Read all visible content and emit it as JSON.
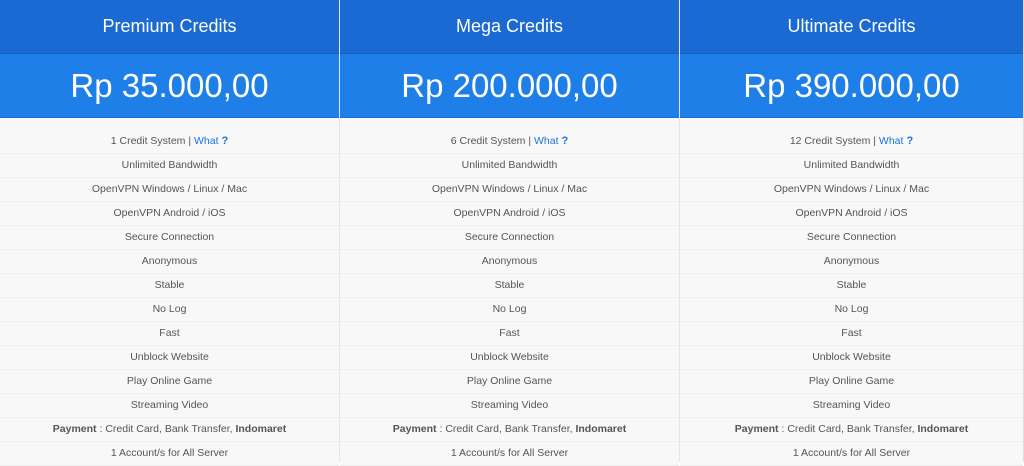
{
  "plans": [
    {
      "title": "Premium Credits",
      "price": "Rp 35.000,00",
      "credit_system": "1 Credit System",
      "separator": " | ",
      "what": "What",
      "help": "?",
      "bandwidth": "Unlimited Bandwidth",
      "openvpn_desktop": "OpenVPN Windows / Linux / Mac",
      "openvpn_mobile": "OpenVPN Android / iOS",
      "secure": "Secure Connection",
      "anonymous": "Anonymous",
      "stable": "Stable",
      "nolog": "No Log",
      "fast": "Fast",
      "unblock": "Unblock Website",
      "game": "Play Online Game",
      "video": "Streaming Video",
      "payment_label": "Payment",
      "payment_methods": " : Credit Card, Bank Transfer, ",
      "payment_bold": "Indomaret",
      "accounts": "1 Account/s for All Server"
    },
    {
      "title": "Mega Credits",
      "price": "Rp 200.000,00",
      "credit_system": "6 Credit System",
      "separator": " | ",
      "what": "What",
      "help": "?",
      "bandwidth": "Unlimited Bandwidth",
      "openvpn_desktop": "OpenVPN Windows / Linux / Mac",
      "openvpn_mobile": "OpenVPN Android / iOS",
      "secure": "Secure Connection",
      "anonymous": "Anonymous",
      "stable": "Stable",
      "nolog": "No Log",
      "fast": "Fast",
      "unblock": "Unblock Website",
      "game": "Play Online Game",
      "video": "Streaming Video",
      "payment_label": "Payment",
      "payment_methods": " : Credit Card, Bank Transfer, ",
      "payment_bold": "Indomaret",
      "accounts": "1 Account/s for All Server"
    },
    {
      "title": "Ultimate Credits",
      "price": "Rp 390.000,00",
      "credit_system": "12 Credit System",
      "separator": " | ",
      "what": "What",
      "help": "?",
      "bandwidth": "Unlimited Bandwidth",
      "openvpn_desktop": "OpenVPN Windows / Linux / Mac",
      "openvpn_mobile": "OpenVPN Android / iOS",
      "secure": "Secure Connection",
      "anonymous": "Anonymous",
      "stable": "Stable",
      "nolog": "No Log",
      "fast": "Fast",
      "unblock": "Unblock Website",
      "game": "Play Online Game",
      "video": "Streaming Video",
      "payment_label": "Payment",
      "payment_methods": " : Credit Card, Bank Transfer, ",
      "payment_bold": "Indomaret",
      "accounts": "1 Account/s for All Server"
    }
  ],
  "colors": {
    "header_blue": "#1b6ad4",
    "price_blue": "#1f7fe8",
    "link_blue": "#1a73d8",
    "text_gray": "#555555",
    "row_bg": "#f8f8f8"
  },
  "icons": {
    "help": "question-mark-icon"
  }
}
